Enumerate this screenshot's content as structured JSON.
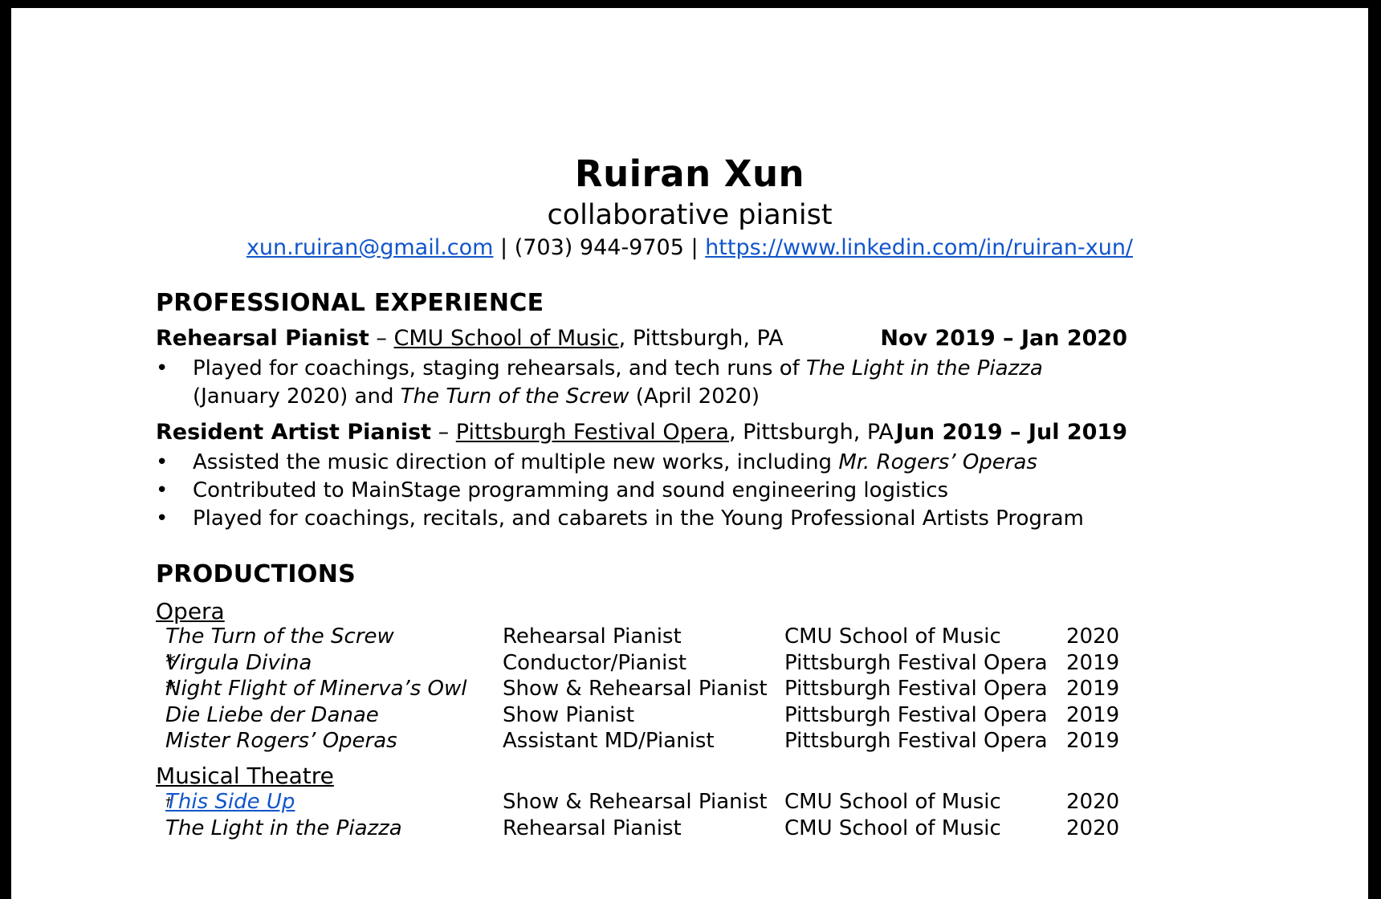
{
  "header": {
    "name": "Ruiran Xun",
    "subtitle": "collaborative pianist",
    "email": "xun.ruiran@gmail.com",
    "sep1": " | ",
    "phone": "(703) 944-9705",
    "sep2": " | ",
    "linkedin": "https://www.linkedin.com/in/ruiran-xun/"
  },
  "experience": {
    "title": "PROFESSIONAL EXPERIENCE",
    "jobs": [
      {
        "role": "Rehearsal Pianist",
        "dash": " – ",
        "org": "CMU School of Music",
        "location": ", Pittsburgh, PA",
        "dates": "Nov 2019 – Jan 2020",
        "bullet1": {
          "a": "Played for coachings, staging rehearsals, and tech runs of ",
          "b": "The Light in the Piazza",
          "c": " (January 2020) and ",
          "d": "The Turn of the Screw",
          "e": " (April 2020)"
        }
      },
      {
        "role": "Resident Artist Pianist",
        "dash": " – ",
        "org": "Pittsburgh Festival Opera",
        "location": ", Pittsburgh, PA",
        "dates": "Jun 2019 – Jul 2019",
        "bullet1": {
          "a": "Assisted the music direction of multiple new works, including ",
          "b": "Mr. Rogers’ Operas"
        },
        "bullet2": "Contributed to MainStage programming and sound engineering logistics",
        "bullet3": "Played for coachings, recitals, and cabarets in the Young Professional Artists Program"
      }
    ]
  },
  "productions": {
    "title": "PRODUCTIONS",
    "opera_label": "Opera",
    "opera": [
      {
        "title": "The Turn of the Screw",
        "mark": "",
        "role": "Rehearsal Pianist",
        "org": "CMU School of Music",
        "year": "2020"
      },
      {
        "title": "Virgula Divina",
        "mark": "*",
        "role": "Conductor/Pianist",
        "org": "Pittsburgh Festival Opera",
        "year": "2019"
      },
      {
        "title": "Night Flight of Minerva’s Owl",
        "mark": "*",
        "role": "Show & Rehearsal Pianist",
        "org": "Pittsburgh Festival Opera",
        "year": "2019"
      },
      {
        "title": "Die Liebe der Danae",
        "mark": "",
        "role": "Show Pianist",
        "org": "Pittsburgh Festival Opera",
        "year": "2019"
      },
      {
        "title": "Mister Rogers’ Operas",
        "mark": "",
        "role": "Assistant MD/Pianist",
        "org": "Pittsburgh Festival Opera",
        "year": "2019"
      }
    ],
    "musical_label": "Musical Theatre",
    "musical": [
      {
        "title": "This Side Up",
        "mark": "†",
        "role": "Show & Rehearsal Pianist",
        "org": "CMU School of Music",
        "year": "2020"
      },
      {
        "title": "The Light in the Piazza",
        "mark": "",
        "role": "Rehearsal Pianist",
        "org": "CMU School of Music",
        "year": "2020"
      }
    ]
  }
}
